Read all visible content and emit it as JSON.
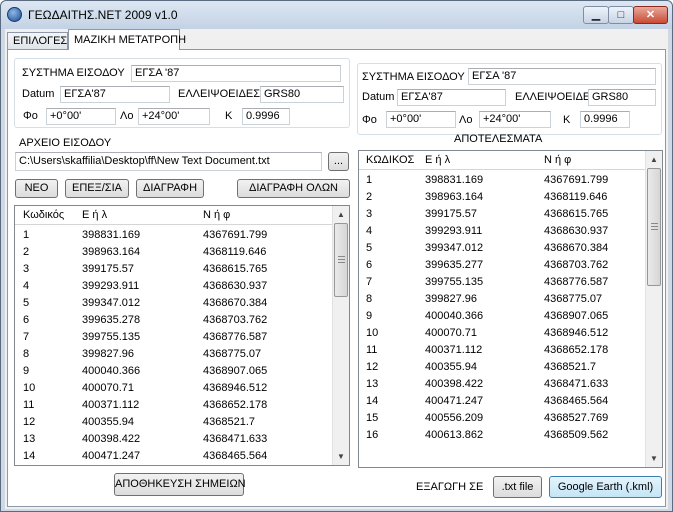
{
  "window": {
    "title": "ΓΕΩΔΑΙΤΗΣ.ΝΕΤ 2009 v1.0",
    "min_label": "▁",
    "max_label": "□",
    "close_label": "✕"
  },
  "tabs": [
    {
      "label": "ΕΠΙΛΟΓΕΣ"
    },
    {
      "label": "ΜΑΖΙΚΗ ΜΕΤΑΤΡΟΠΗ"
    }
  ],
  "input_system": {
    "system_label": "ΣΥΣΤΗΜΑ ΕΙΣΟΔΟΥ",
    "system_value": "ΕΓΣΑ '87",
    "datum_label": "Datum",
    "datum_value": "ΕΓΣΑ'87",
    "ellipsoid_label": "ΕΛΛΕΙΨΟΕΙΔΕΣ",
    "ellipsoid_value": "GRS80",
    "phi_label": "Φο",
    "phi_value": "+0°00'",
    "lambda_label": "Λο",
    "lambda_value": "+24°00'",
    "k_label": "Κ",
    "k_value": "0.9996"
  },
  "output_system": {
    "system_label": "ΣΥΣΤΗΜΑ ΕΙΣΟΔΟΥ",
    "system_value": "ΕΓΣΑ '87",
    "datum_label": "Datum",
    "datum_value": "ΕΓΣΑ'87",
    "ellipsoid_label": "ΕΛΛΕΙΨΟΕΙΔΕΣ",
    "ellipsoid_value": "GRS80",
    "phi_label": "Φο",
    "phi_value": "+0°00'",
    "lambda_label": "Λο",
    "lambda_value": "+24°00'",
    "k_label": "Κ",
    "k_value": "0.9996"
  },
  "input_file": {
    "label": "ΑΡΧΕΙΟ ΕΙΣΟΔΟΥ",
    "path": "C:\\Users\\skaffilia\\Desktop\\ff\\New Text Document.txt",
    "browse_label": "..."
  },
  "actions": {
    "new": "ΝΕΟ",
    "edit": "ΕΠΕΞ/ΣΙΑ",
    "delete": "ΔΙΑΓΡΑΦΗ",
    "delete_all": "ΔΙΑΓΡΑΦΗ ΟΛΩΝ",
    "save_points": "ΑΠΟΘΗΚΕΥΣΗ ΣΗΜΕΙΩΝ"
  },
  "input_table": {
    "headers": [
      "Κωδικός",
      "Ε ή λ",
      "Ν ή φ"
    ],
    "rows": [
      [
        "1",
        "398831.169",
        "4367691.799"
      ],
      [
        "2",
        "398963.164",
        "4368119.646"
      ],
      [
        "3",
        "399175.57",
        "4368615.765"
      ],
      [
        "4",
        "399293.911",
        "4368630.937"
      ],
      [
        "5",
        "399347.012",
        "4368670.384"
      ],
      [
        "6",
        "399635.278",
        "4368703.762"
      ],
      [
        "7",
        "399755.135",
        "4368776.587"
      ],
      [
        "8",
        "399827.96",
        "4368775.07"
      ],
      [
        "9",
        "400040.366",
        "4368907.065"
      ],
      [
        "10",
        "400070.71",
        "4368946.512"
      ],
      [
        "11",
        "400371.112",
        "4368652.178"
      ],
      [
        "12",
        "400355.94",
        "4368521.7"
      ],
      [
        "13",
        "400398.422",
        "4368471.633"
      ],
      [
        "14",
        "400471.247",
        "4368465.564"
      ]
    ]
  },
  "results": {
    "title": "ΑΠΟΤΕΛΕΣΜΑΤΑ",
    "headers": [
      "ΚΩΔΙΚΟΣ",
      "Ε ή λ",
      "Ν ή φ"
    ],
    "rows": [
      [
        "1",
        "398831.169",
        "4367691.799"
      ],
      [
        "2",
        "398963.164",
        "4368119.646"
      ],
      [
        "3",
        "399175.57",
        "4368615.765"
      ],
      [
        "4",
        "399293.911",
        "4368630.937"
      ],
      [
        "5",
        "399347.012",
        "4368670.384"
      ],
      [
        "6",
        "399635.277",
        "4368703.762"
      ],
      [
        "7",
        "399755.135",
        "4368776.587"
      ],
      [
        "8",
        "399827.96",
        "4368775.07"
      ],
      [
        "9",
        "400040.366",
        "4368907.065"
      ],
      [
        "10",
        "400070.71",
        "4368946.512"
      ],
      [
        "11",
        "400371.112",
        "4368652.178"
      ],
      [
        "12",
        "400355.94",
        "4368521.7"
      ],
      [
        "13",
        "400398.422",
        "4368471.633"
      ],
      [
        "14",
        "400471.247",
        "4368465.564"
      ],
      [
        "15",
        "400556.209",
        "4368527.769"
      ],
      [
        "16",
        "400613.862",
        "4368509.562"
      ]
    ]
  },
  "export": {
    "label": "ΕΞΑΓΩΓΗ ΣΕ",
    "txt_label": ".txt file",
    "kml_label": "Google Earth (.kml)"
  }
}
